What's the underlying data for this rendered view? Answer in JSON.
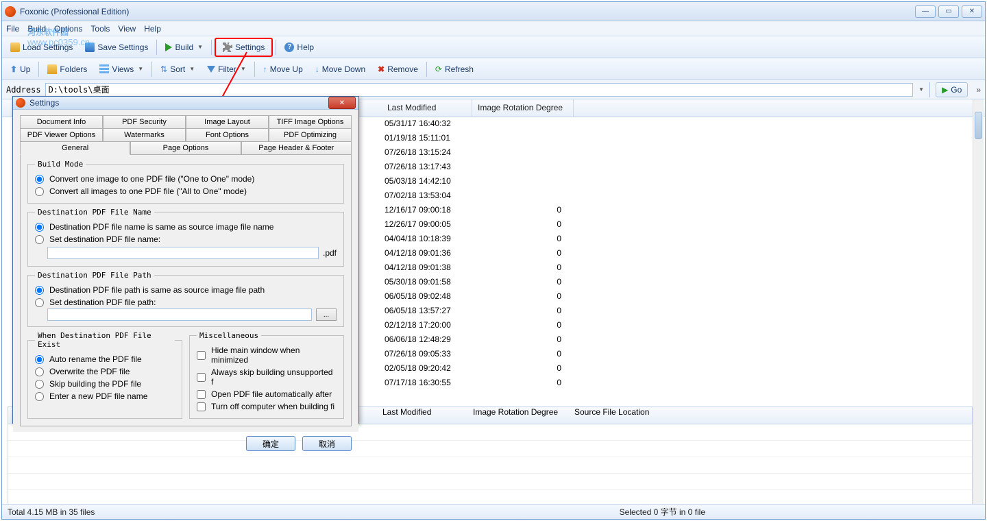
{
  "window": {
    "title": "Foxonic (Professional Edition)"
  },
  "menu": {
    "file": "File",
    "build": "Build",
    "options": "Options",
    "tools": "Tools",
    "view": "View",
    "help": "Help"
  },
  "toolbar1": {
    "load": "Load Settings",
    "save": "Save Settings",
    "build": "Build",
    "settings": "Settings",
    "help": "Help"
  },
  "toolbar2": {
    "up": "Up",
    "folders": "Folders",
    "views": "Views",
    "sort": "Sort",
    "filter": "Filter",
    "moveup": "Move Up",
    "movedown": "Move Down",
    "remove": "Remove",
    "refresh": "Refresh"
  },
  "address": {
    "label": "Address",
    "value": "D:\\tools\\桌面",
    "go": "Go"
  },
  "columns": {
    "last_modified": "Last Modified",
    "rotation": "Image Rotation Degree",
    "source": "Source File Location"
  },
  "rows": [
    {
      "lm": "05/31/17 16:40:32",
      "rot": ""
    },
    {
      "lm": "01/19/18 15:11:01",
      "rot": ""
    },
    {
      "lm": "07/26/18 13:15:24",
      "rot": ""
    },
    {
      "lm": "07/26/18 13:17:43",
      "rot": ""
    },
    {
      "lm": "05/03/18 14:42:10",
      "rot": ""
    },
    {
      "lm": "07/02/18 13:53:04",
      "rot": ""
    },
    {
      "lm": "12/16/17 09:00:18",
      "rot": "0"
    },
    {
      "lm": "12/26/17 09:00:05",
      "rot": "0"
    },
    {
      "lm": "04/04/18 10:18:39",
      "rot": "0"
    },
    {
      "lm": "04/12/18 09:01:36",
      "rot": "0"
    },
    {
      "lm": "04/12/18 09:01:38",
      "rot": "0"
    },
    {
      "lm": "05/30/18 09:01:58",
      "rot": "0"
    },
    {
      "lm": "06/05/18 09:02:48",
      "rot": "0"
    },
    {
      "lm": "06/05/18 13:57:27",
      "rot": "0"
    },
    {
      "lm": "02/12/18 17:20:00",
      "rot": "0"
    },
    {
      "lm": "06/06/18 12:48:29",
      "rot": "0"
    },
    {
      "lm": "07/26/18 09:05:33",
      "rot": "0"
    },
    {
      "lm": "02/05/18 09:20:42",
      "rot": "0"
    },
    {
      "lm": "07/17/18 16:30:55",
      "rot": "0"
    }
  ],
  "status": {
    "left": "Total 4.15 MB in 35 files",
    "right": "Selected 0 字节 in 0 file"
  },
  "watermark": {
    "main": "河东软件园",
    "sub": "www.pc0359.cn"
  },
  "dialog": {
    "title": "Settings",
    "tabs_row1": [
      "Document Info",
      "PDF Security",
      "Image Layout",
      "TIFF Image Options"
    ],
    "tabs_row2": [
      "PDF Viewer Options",
      "Watermarks",
      "Font Options",
      "PDF Optimizing"
    ],
    "tabs_row3": [
      "General",
      "Page Options",
      "Page Header & Footer"
    ],
    "active_tab": "General",
    "build_mode": {
      "legend": "Build Mode",
      "opt1": "Convert one image to one PDF file (\"One to One\" mode)",
      "opt2": "Convert all images to one PDF file (\"All to One\" mode)"
    },
    "dest_name": {
      "legend": "Destination PDF File Name",
      "opt1": "Destination PDF file name is same as source image file name",
      "opt2": "Set destination PDF file name:",
      "suffix": ".pdf"
    },
    "dest_path": {
      "legend": "Destination PDF File Path",
      "opt1": "Destination PDF file path is same as source image file path",
      "opt2": "Set destination PDF file path:",
      "browse": "..."
    },
    "when_exist": {
      "legend": "When Destination PDF File Exist",
      "opt1": "Auto rename the PDF file",
      "opt2": "Overwrite the PDF file",
      "opt3": "Skip building the PDF file",
      "opt4": "Enter a new PDF file name"
    },
    "misc": {
      "legend": "Miscellaneous",
      "chk1": "Hide main window when minimized",
      "chk2": "Always skip building unsupported f",
      "chk3": "Open PDF file automatically after",
      "chk4": "Turn off computer when building fi"
    },
    "ok": "确定",
    "cancel": "取消"
  }
}
